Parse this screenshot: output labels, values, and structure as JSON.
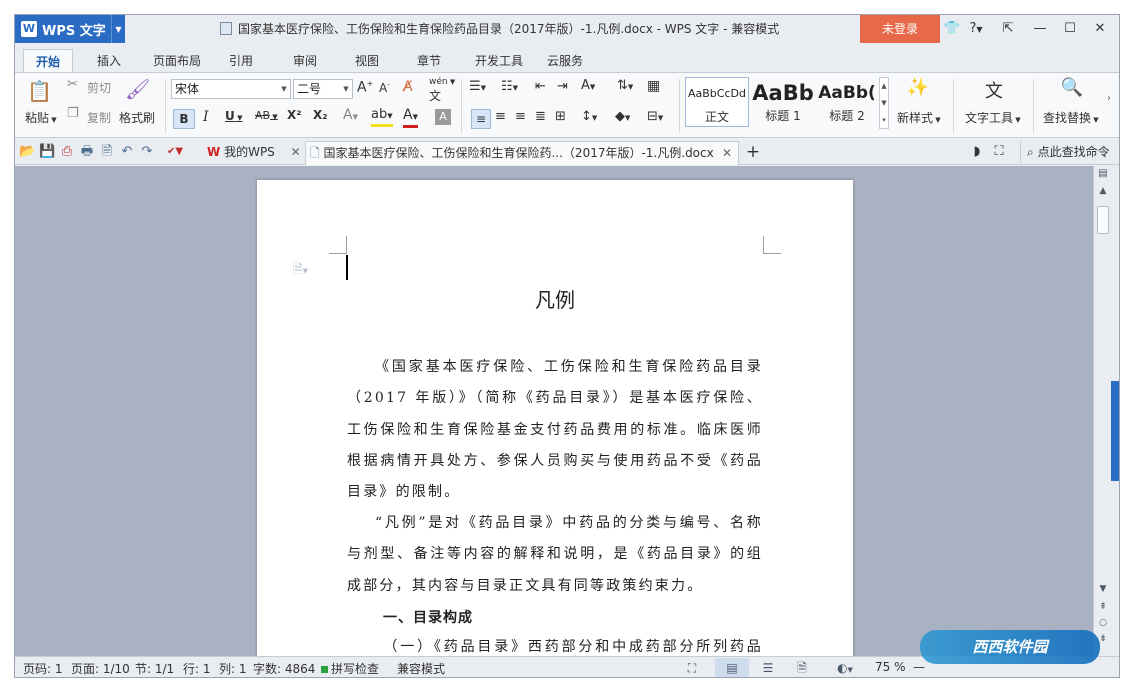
{
  "app": {
    "badge_label": "WPS 文字",
    "document_title": "国家基本医疗保险、工伤保险和生育保险药品目录（2017年版）-1.凡例.docx - WPS 文字 - 兼容模式",
    "login_label": "未登录",
    "help_label": "?"
  },
  "ribbon_tabs": [
    "开始",
    "插入",
    "页面布局",
    "引用",
    "审阅",
    "视图",
    "章节",
    "开发工具",
    "云服务"
  ],
  "ribbon": {
    "paste": "粘贴",
    "cut": "剪切",
    "copy": "复制",
    "format_painter": "格式刷",
    "font_name": "宋体",
    "font_size": "二号",
    "bold": "B",
    "italic": "I",
    "underline": "U",
    "strike": "AB",
    "superscript": "X²",
    "subscript": "X₂",
    "wen": "wén",
    "styles": [
      {
        "preview": "AaBbCcDd",
        "name": "正文"
      },
      {
        "preview": "AaBb",
        "name": "标题 1"
      },
      {
        "preview": "AaBb(",
        "name": "标题 2"
      }
    ],
    "new_style": "新样式",
    "text_tools": "文字工具",
    "find_replace": "查找替换"
  },
  "doc_tabs": {
    "home_tab": "我的WPS",
    "doc_tab": "国家基本医疗保险、工伤保险和生育保险药...（2017年版）-1.凡例.docx",
    "search_command": "点此查找命令"
  },
  "document": {
    "heading": "凡例",
    "paragraphs": [
      "《国家基本医疗保险、工伤保险和生育保险药品目录（2017 年版）》（简称《药品目录》）是基本医疗保险、工伤保险和生育保险基金支付药品费用的标准。临床医师根据病情开具处方、参保人员购买与使用药品不受《药品目录》的限制。",
      "“凡例”是对《药品目录》中药品的分类与编号、名称与剂型、备注等内容的解释和说明，是《药品目录》的组成部分，其内容与目录正文具有同等政策约束力。"
    ],
    "section_heading": "一、目录构成",
    "partial_line": "（一）《药品目录》西药部分和中成药部分所列药品为"
  },
  "status": {
    "page_num": "页码: 1",
    "pages": "页面: 1/10",
    "section": "节: 1/1",
    "row": "行: 1",
    "col": "列: 1",
    "word_count": "字数: 4864",
    "spell_check": "拼写检查",
    "compat_mode": "兼容模式",
    "zoom": "75 %"
  },
  "watermark": "西西软件园"
}
